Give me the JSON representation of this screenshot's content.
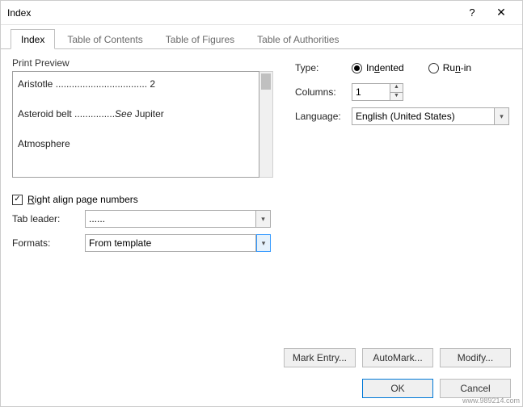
{
  "dialog": {
    "title": "Index",
    "help_symbol": "?",
    "close_symbol": "✕"
  },
  "tabs": {
    "t0": "Index",
    "t1": "Table of Contents",
    "t2": "Table of Figures",
    "t3": "Table of Authorities"
  },
  "preview": {
    "label": "Print Preview",
    "line1_text": "Aristotle",
    "line1_leader": " .................................. ",
    "line1_page": "2",
    "line2_text": "Asteroid belt",
    "line2_leader": " ...............",
    "line2_see": "See",
    "line2_ref": " Jupiter",
    "line3_text": "Atmosphere"
  },
  "options": {
    "type_label": "Type:",
    "type_indented_prefix": "In",
    "type_indented_u": "d",
    "type_indented_suffix": "ented",
    "type_runin_prefix": "Ru",
    "type_runin_u": "n",
    "type_runin_suffix": "-in",
    "columns_label": "Columns:",
    "columns_value": "1",
    "language_label": "Language:",
    "language_value": "English (United States)"
  },
  "lower": {
    "right_align_prefix": "",
    "right_align_u": "R",
    "right_align_suffix": "ight align page numbers",
    "right_align_checked": "✓",
    "tab_leader_label": "Tab leader:",
    "tab_leader_value": "......",
    "formats_label": "Formats:",
    "formats_value": "From template"
  },
  "buttons": {
    "mark_entry": "Mark Entry...",
    "automark": "AutoMark...",
    "modify": "Modify...",
    "ok": "OK",
    "cancel": "Cancel"
  },
  "watermark": "www.989214.com"
}
